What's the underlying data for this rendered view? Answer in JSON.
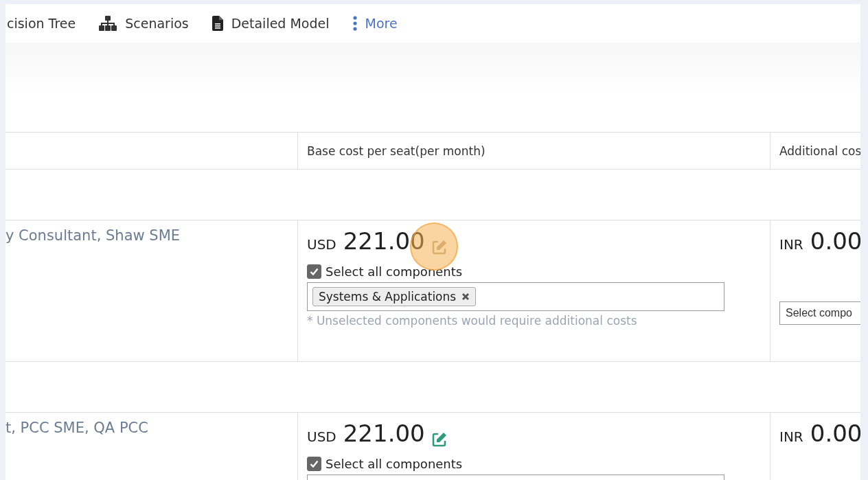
{
  "nav": {
    "items": [
      {
        "kind": "text",
        "label": "cision Tree"
      },
      {
        "kind": "sitemap",
        "label": "Scenarios"
      },
      {
        "kind": "document",
        "label": "Detailed Model"
      },
      {
        "kind": "more",
        "label": "More"
      }
    ]
  },
  "table": {
    "columns": [
      "",
      "Base cost per seat(per month)",
      "Additional cos"
    ],
    "rows": [
      {
        "roles": "y Consultant, Shaw SME",
        "currency": "USD",
        "amount": "221.00",
        "edit_highlighted": true,
        "select_all": {
          "label": "Select all components",
          "checked": true
        },
        "tags": [
          "Systems & Applications"
        ],
        "note": "* Unselected components would require additional costs",
        "extra_currency": "INR",
        "extra_amount": "0.00",
        "extra_select": {
          "placeholder": "Select compo"
        }
      },
      {
        "roles": "t, PCC SME, QA PCC",
        "currency": "USD",
        "amount": "221.00",
        "edit_highlighted": false,
        "select_all": {
          "label": "Select all components",
          "checked": true
        },
        "tags": [],
        "extra_currency": "INR",
        "extra_amount": "0.00"
      }
    ]
  }
}
